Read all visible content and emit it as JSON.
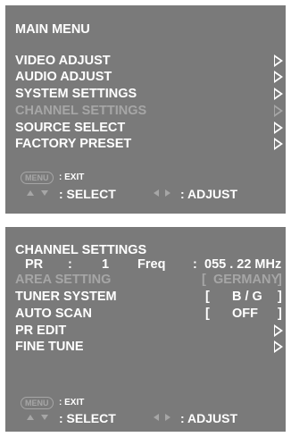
{
  "colors": {
    "panel_bg": "#7a7a7a",
    "text": "#ffffff",
    "disabled_text": "#a6a6a6"
  },
  "main_menu": {
    "title": "MAIN MENU",
    "items": [
      {
        "label": "VIDEO ADJUST",
        "icon": "right-triangle-icon",
        "enabled": true
      },
      {
        "label": "AUDIO ADJUST",
        "icon": "right-triangle-icon",
        "enabled": true
      },
      {
        "label": "SYSTEM SETTINGS",
        "icon": "right-triangle-icon",
        "enabled": true
      },
      {
        "label": "CHANNEL SETTINGS",
        "icon": "right-triangle-icon",
        "enabled": false
      },
      {
        "label": "SOURCE SELECT",
        "icon": "right-triangle-icon",
        "enabled": true
      },
      {
        "label": "FACTORY PRESET",
        "icon": "right-triangle-icon",
        "enabled": true
      }
    ],
    "help": {
      "menu_key": "MENU",
      "exit": ": EXIT",
      "select": ": SELECT",
      "adjust": ": ADJUST"
    }
  },
  "channel_settings": {
    "title": "CHANNEL SETTINGS",
    "pr_label": "PR",
    "pr_sep": ":",
    "pr_value": "1",
    "freq_label": "Freq",
    "freq_sep": ":",
    "freq_value": "055 . 22 MHz",
    "rows": [
      {
        "label": "AREA SETTING",
        "lb": "[",
        "value": "GERMANY",
        "rb": "]",
        "enabled": false
      },
      {
        "label": "TUNER SYSTEM",
        "lb": "[",
        "value": "B / G",
        "rb": "]",
        "enabled": true
      },
      {
        "label": "AUTO SCAN",
        "lb": "[",
        "value": "OFF",
        "rb": "]",
        "enabled": true
      }
    ],
    "submenu_items": [
      {
        "label": "PR EDIT",
        "icon": "right-triangle-icon"
      },
      {
        "label": "FINE TUNE",
        "icon": "right-triangle-icon"
      }
    ],
    "help": {
      "menu_key": "MENU",
      "exit": ": EXIT",
      "select": ": SELECT",
      "adjust": ": ADJUST"
    }
  }
}
